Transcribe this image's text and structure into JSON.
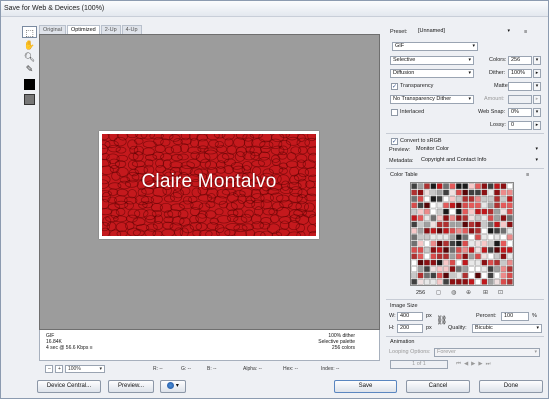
{
  "window": {
    "title": "Save for Web & Devices (100%)"
  },
  "tools": [
    "slice-select-icon",
    "hand-icon",
    "zoom-icon",
    "eyedropper-icon",
    "eyedropper-color-swatch",
    "toggle-slices-icon"
  ],
  "tabs": [
    {
      "label": "Original"
    },
    {
      "label": "Optimized"
    },
    {
      "label": "2-Up"
    },
    {
      "label": "4-Up"
    }
  ],
  "image": {
    "text": "Claire Montalvo",
    "color": "#c5191d"
  },
  "info": {
    "format": "GIF",
    "size": "16.84K",
    "time": "4 sec @ 56.6 Kbps",
    "time_icon": "≡",
    "dither": "100% dither",
    "palette": "Selective palette",
    "colors": "256 colors"
  },
  "status": {
    "zoom": "100%",
    "r": "R: --",
    "g": "G: --",
    "b": "B: --",
    "alpha": "Alpha: --",
    "hex": "Hex: --",
    "index": "Index: --"
  },
  "panel": {
    "preset_label": "Preset:",
    "preset_value": "[Unnamed]",
    "preset_menu": "≡",
    "format": "GIF",
    "reduction": "Selective",
    "colors_label": "Colors:",
    "colors_value": "256",
    "dither_algo": "Diffusion",
    "dither_label": "Dither:",
    "dither_value": "100%",
    "transparency_label": "Transparency",
    "matte_label": "Matte:",
    "trans_dither": "No Transparency Dither",
    "amount_label": "Amount:",
    "interlaced_label": "Interlaced",
    "websnap_label": "Web Snap:",
    "websnap_value": "0%",
    "lossy_label": "Lossy:",
    "lossy_value": "0",
    "convert_label": "Convert to sRGB",
    "preview_label": "Preview:",
    "preview_value": "Monitor Color",
    "metadata_label": "Metadata:",
    "metadata_value": "Copyright and Contact Info",
    "color_table_label": "Color Table",
    "ct_menu": "≡",
    "ct_count": "256",
    "image_size_label": "Image Size",
    "w_label": "W:",
    "w_value": "400",
    "h_label": "H:",
    "h_value": "200",
    "px": "px",
    "percent_label": "Percent:",
    "percent_value": "100",
    "pct": "%",
    "quality_label": "Quality:",
    "quality_value": "Bicubic",
    "animation_label": "Animation",
    "looping_label": "Looping Options:",
    "looping_value": "Forever",
    "frame_value": "1 of 1"
  },
  "buttons": {
    "device_central": "Device Central...",
    "preview": "Preview...",
    "save": "Save",
    "cancel": "Cancel",
    "done": "Done"
  }
}
